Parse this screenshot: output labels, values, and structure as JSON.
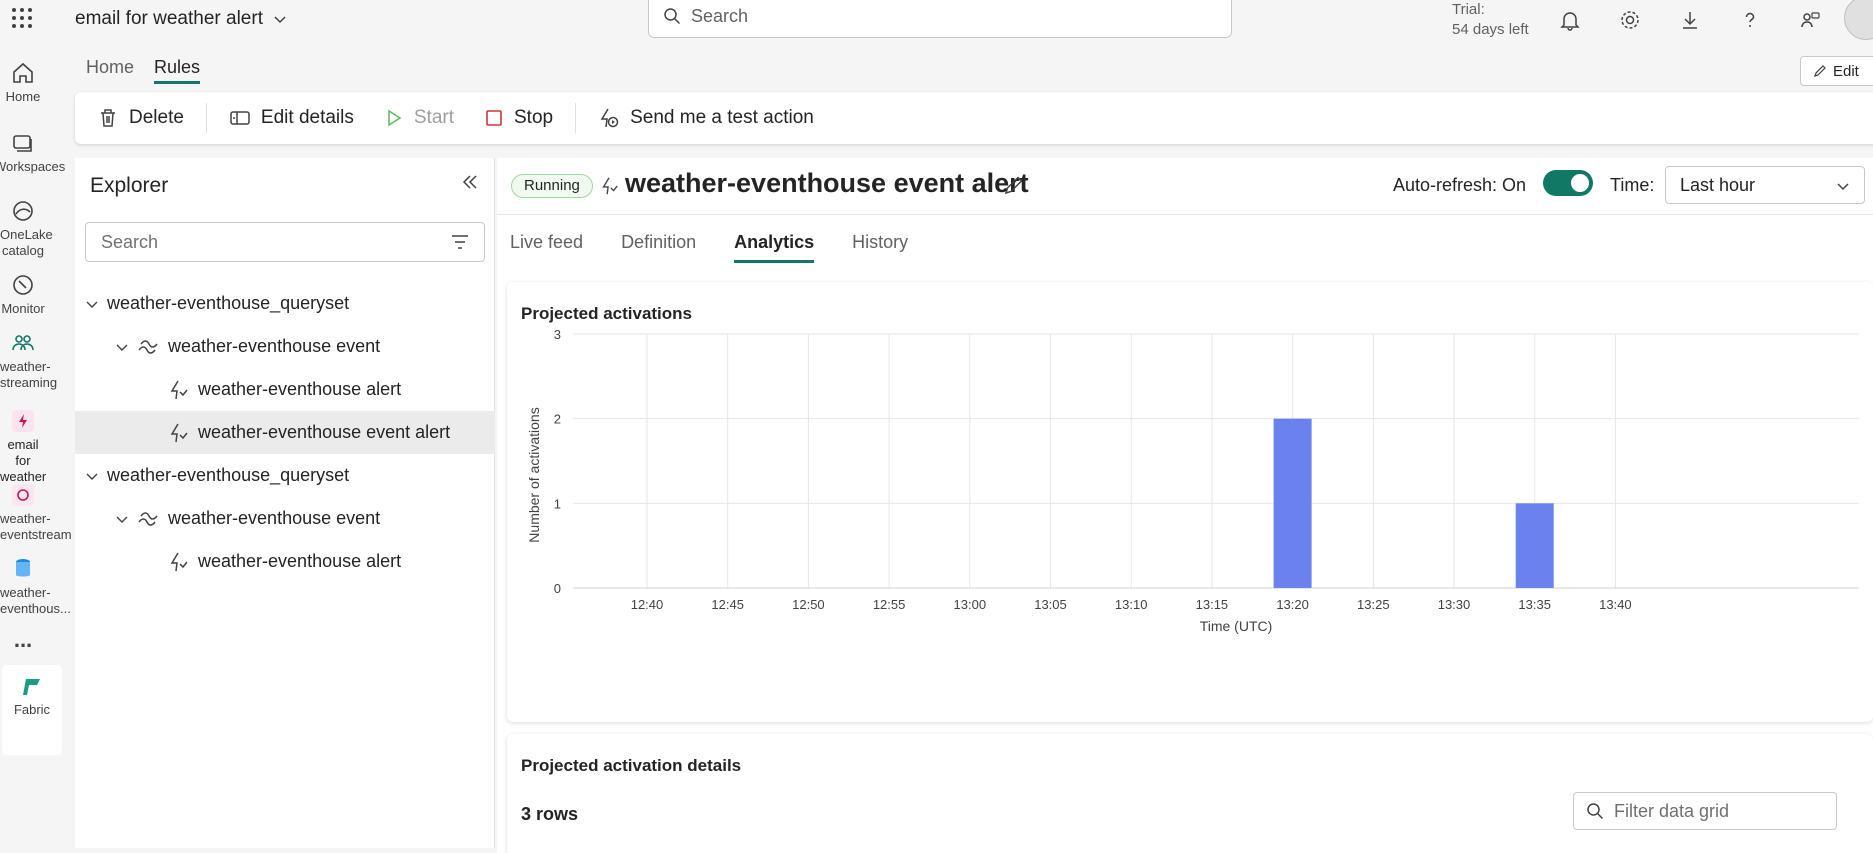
{
  "app": {
    "name": "email for weather alert"
  },
  "global_search": {
    "placeholder": "Search"
  },
  "trial": {
    "line1": "Trial:",
    "line2": "54 days left"
  },
  "leftnav": {
    "items": [
      {
        "label": "Home"
      },
      {
        "label": "Workspaces"
      },
      {
        "label": "OneLake catalog"
      },
      {
        "label": "Monitor"
      },
      {
        "label": "weather-streaming"
      },
      {
        "label": "email for weather ..."
      },
      {
        "label": "weather-eventstream"
      },
      {
        "label": "weather-eventhous..."
      }
    ],
    "more": "...",
    "fabric": "Fabric"
  },
  "top_tabs": [
    {
      "label": "Home"
    },
    {
      "label": "Rules"
    }
  ],
  "edit_button": "Edit",
  "toolbar": {
    "delete": "Delete",
    "edit_details": "Edit details",
    "start": "Start",
    "stop": "Stop",
    "test_action": "Send me a test action"
  },
  "explorer": {
    "title": "Explorer",
    "search_placeholder": "Search",
    "tree": [
      {
        "label": "weather-eventhouse_queryset"
      },
      {
        "label": "weather-eventhouse event"
      },
      {
        "label": "weather-eventhouse alert"
      },
      {
        "label": "weather-eventhouse event alert"
      },
      {
        "label": "weather-eventhouse_queryset"
      },
      {
        "label": "weather-eventhouse event"
      },
      {
        "label": "weather-eventhouse alert"
      }
    ]
  },
  "rule": {
    "status": "Running",
    "title": "weather-eventhouse event alert",
    "autorefresh_label": "Auto-refresh:",
    "autorefresh_value": "On",
    "time_label": "Time:",
    "time_value": "Last hour"
  },
  "subtabs": [
    {
      "label": "Live feed"
    },
    {
      "label": "Definition"
    },
    {
      "label": "Analytics"
    },
    {
      "label": "History"
    }
  ],
  "chart_card": {
    "title": "Projected activations"
  },
  "details_card": {
    "title": "Projected activation details",
    "rows": "3 rows",
    "filter_placeholder": "Filter data grid"
  },
  "colors": {
    "accent": "#117865",
    "bar": "#6b82ee"
  },
  "chart_data": {
    "type": "bar",
    "title": "Projected activations",
    "xlabel": "Time (UTC)",
    "ylabel": "Number of activations",
    "categories": [
      "12:40",
      "12:45",
      "12:50",
      "12:55",
      "13:00",
      "13:05",
      "13:10",
      "13:15",
      "13:20",
      "13:25",
      "13:30",
      "13:35",
      "13:40"
    ],
    "x_ticks": [
      "12:40",
      "12:45",
      "12:50",
      "12:55",
      "13:00",
      "13:05",
      "13:10",
      "13:15",
      "13:20",
      "13:25",
      "13:30",
      "13:35",
      "13:40"
    ],
    "y_ticks": [
      "0",
      "1",
      "2",
      "3"
    ],
    "series": [
      {
        "values": [
          0,
          0,
          0,
          0,
          0,
          0,
          0,
          0,
          2,
          0,
          0,
          1,
          0
        ]
      }
    ],
    "ylim": [
      0,
      3
    ],
    "grid": true
  }
}
